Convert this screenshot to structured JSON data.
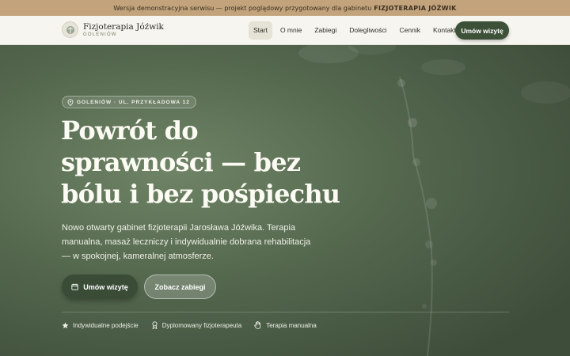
{
  "announcement": {
    "text": "Wersja demonstracyjna serwisu — projekt poglądowy przygotowany dla gabinetu",
    "highlight": "FIZJOTERAPIA JÓŹWIK"
  },
  "brand": {
    "name": "Fizjoterapia Jóźwik",
    "location": "GOLENIÓW"
  },
  "nav": {
    "items": [
      {
        "label": "Start"
      },
      {
        "label": "O mnie"
      },
      {
        "label": "Zabiegi"
      },
      {
        "label": "Dolegliwości"
      },
      {
        "label": "Cennik"
      },
      {
        "label": "Kontakt"
      }
    ],
    "active": "Start",
    "cta_label": "Umów wizytę"
  },
  "hero": {
    "badge": "GOLENIÓW · UL. PRZYKŁADOWA 12",
    "title": "Powrót do sprawności — bez bólu i bez pośpiechu",
    "description": "Nowo otwarty gabinet fizjoterapii Jarosława Jóźwika. Terapia manualna, masaż leczniczy i indywidualnie dobrana rehabilitacja — w spokojnej, kameralnej atmosferze.",
    "primary_button": "Umów wizytę",
    "secondary_button": "Zobacz zabiegi",
    "features": [
      {
        "label": "Indywidualne podejście",
        "icon": "star-icon"
      },
      {
        "label": "Dyplomowany fizjoterapeuta",
        "icon": "award-icon"
      },
      {
        "label": "Terapia manualna",
        "icon": "hand-icon"
      }
    ]
  },
  "colors": {
    "announcement_bg": "#c2a37b",
    "navbar_bg": "#f6f5ef",
    "accent": "#3d5139",
    "hero_bg": "#55694f"
  }
}
